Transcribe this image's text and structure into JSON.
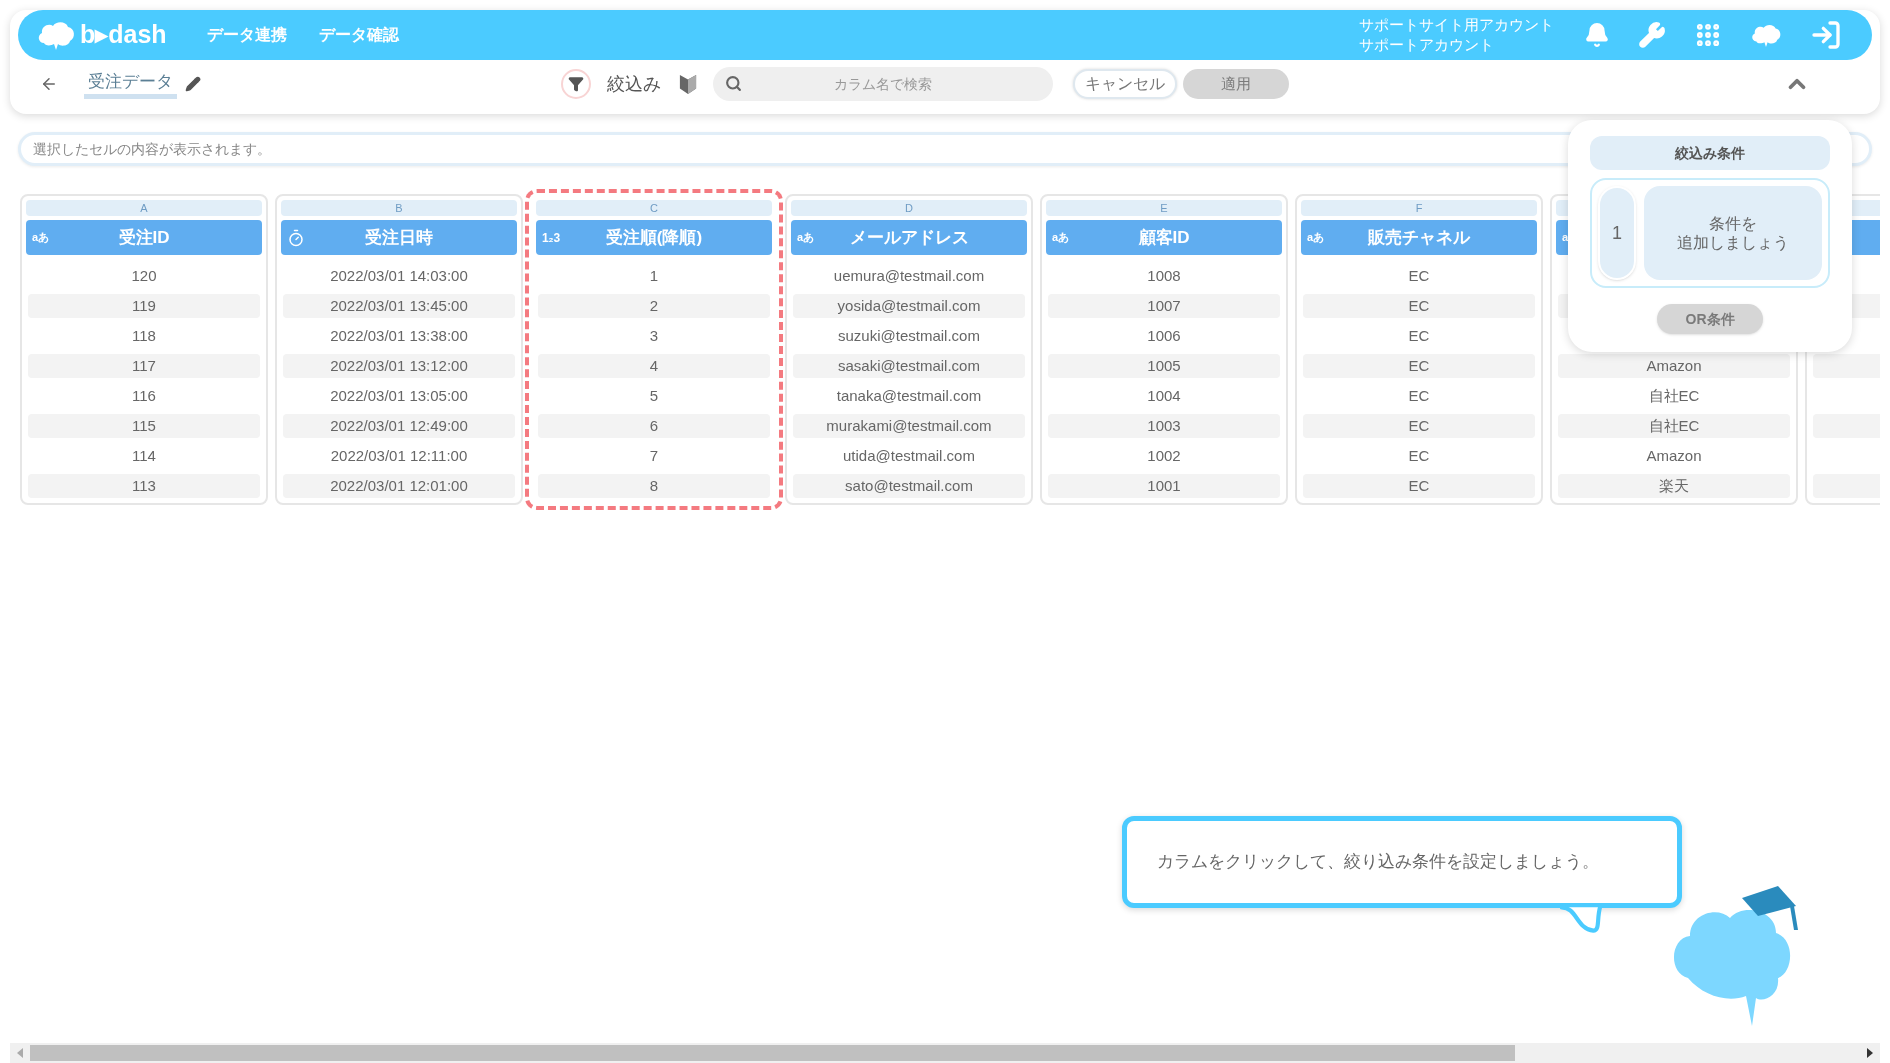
{
  "header": {
    "logo": "b▸dash",
    "nav": [
      "データ連携",
      "データ確認"
    ],
    "account": [
      "サポートサイト用アカウント",
      "サポートアカウント"
    ]
  },
  "toolbar": {
    "title": "受注データ",
    "filter_label": "絞込み",
    "search": {
      "placeholder": "カラム名で検索"
    },
    "cancel": "キャンセル",
    "apply": {
      "label": "適用",
      "disabled": true
    }
  },
  "cell_display": {
    "placeholder": "選択したセルの内容が表示されます。"
  },
  "columns": [
    {
      "letter": "A",
      "kind": "text",
      "type_label": "aあ",
      "name": "受注ID",
      "highlighted": false,
      "cells": [
        "120",
        "119",
        "118",
        "117",
        "116",
        "115",
        "114",
        "113"
      ]
    },
    {
      "letter": "B",
      "kind": "datetime",
      "name": "受注日時",
      "highlighted": false,
      "cells": [
        "2022/03/01 14:03:00",
        "2022/03/01 13:45:00",
        "2022/03/01 13:38:00",
        "2022/03/01 13:12:00",
        "2022/03/01 13:05:00",
        "2022/03/01 12:49:00",
        "2022/03/01 12:11:00",
        "2022/03/01 12:01:00"
      ]
    },
    {
      "letter": "C",
      "kind": "number",
      "type_label": "1₂3",
      "name": "受注順(降順)",
      "highlighted": true,
      "cells": [
        "1",
        "2",
        "3",
        "4",
        "5",
        "6",
        "7",
        "8"
      ]
    },
    {
      "letter": "D",
      "kind": "text",
      "type_label": "aあ",
      "name": "メールアドレス",
      "highlighted": false,
      "cells": [
        "uemura@testmail.com",
        "yosida@testmail.com",
        "suzuki@testmail.com",
        "sasaki@testmail.com",
        "tanaka@testmail.com",
        "murakami@testmail.com",
        "utida@testmail.com",
        "sato@testmail.com"
      ]
    },
    {
      "letter": "E",
      "kind": "text",
      "type_label": "aあ",
      "name": "顧客ID",
      "highlighted": false,
      "cells": [
        "1008",
        "1007",
        "1006",
        "1005",
        "1004",
        "1003",
        "1002",
        "1001"
      ]
    },
    {
      "letter": "F",
      "kind": "text",
      "type_label": "aあ",
      "name": "販売チャネル",
      "highlighted": false,
      "cells": [
        "EC",
        "EC",
        "EC",
        "EC",
        "EC",
        "EC",
        "EC",
        "EC"
      ]
    },
    {
      "kind": "text",
      "type_label": "a",
      "highlighted": false,
      "cells": [
        null,
        null,
        null,
        "Amazon",
        "自社EC",
        "自社EC",
        "Amazon",
        "楽天"
      ]
    },
    {
      "kind": "text",
      "highlighted": false,
      "cells": [
        null,
        null,
        null,
        null,
        null,
        null,
        null,
        null
      ]
    }
  ],
  "filter_panel": {
    "title": "絞込み条件",
    "conditions": [
      {
        "index": "1",
        "text_lines": [
          "条件を",
          "追加しましょう"
        ]
      }
    ],
    "or_button": {
      "label": "OR条件",
      "disabled": true
    }
  },
  "hint_bubble": {
    "text": "カラムをクリックして、絞り込み条件を設定しましょう。"
  }
}
